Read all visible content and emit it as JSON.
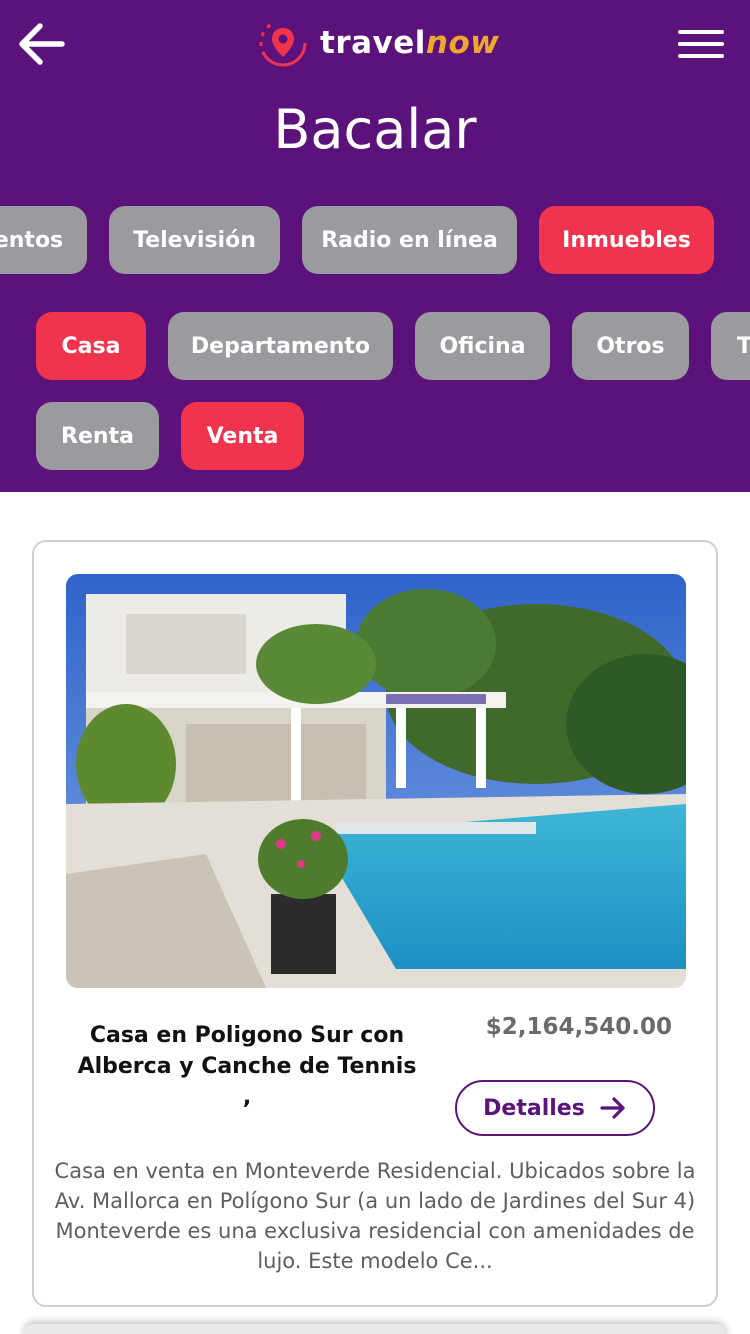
{
  "header": {
    "brand_part1": "travel",
    "brand_part2": "now",
    "city_title": "Bacalar",
    "brand_color": "#5b127a",
    "accent_color": "#f0344d"
  },
  "categories": [
    {
      "label": "entos",
      "active": false
    },
    {
      "label": "Televisión",
      "active": false
    },
    {
      "label": "Radio en línea",
      "active": false
    },
    {
      "label": "Inmuebles",
      "active": true
    }
  ],
  "property_types": [
    {
      "label": "Casa",
      "active": true
    },
    {
      "label": "Departamento",
      "active": false
    },
    {
      "label": "Oficina",
      "active": false
    },
    {
      "label": "Otros",
      "active": false
    },
    {
      "label": "T",
      "active": false
    }
  ],
  "operation_types": [
    {
      "label": "Renta",
      "active": false
    },
    {
      "label": "Venta",
      "active": true
    }
  ],
  "listing": {
    "title_line1": "Casa en Poligono Sur con",
    "title_line2": "Alberca y Canche de Tennis",
    "title_line3": ",",
    "price": "$2,164,540.00",
    "details_label": "Detalles",
    "description": "Casa en venta en Monteverde Residencial. Ubicados sobre la Av. Mallorca en Polígono Sur (a un lado de Jardines del Sur 4) Monteverde es una exclusiva residencial con amenidades de lujo. Este modelo Ce..."
  },
  "icons": {
    "back": "arrow-left-icon",
    "menu": "hamburger-menu-icon",
    "logo": "location-pin-icon",
    "details": "arrow-right-icon"
  }
}
